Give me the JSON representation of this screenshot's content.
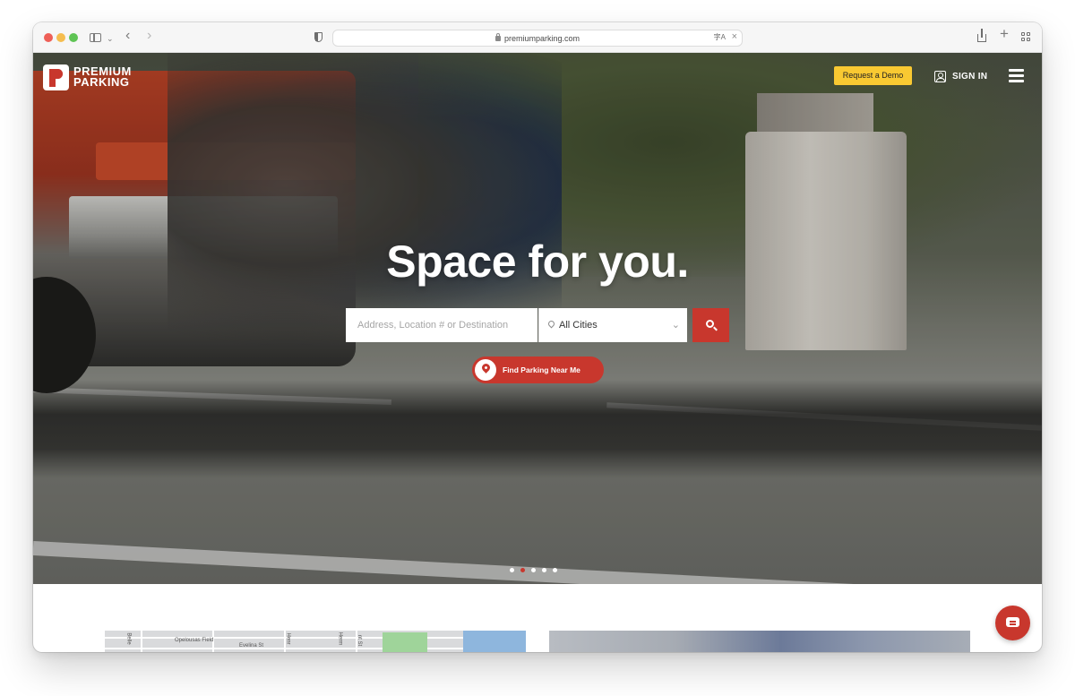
{
  "browser": {
    "url": "premiumparking.com"
  },
  "site": {
    "logo_line1": "PREMIUM",
    "logo_line2": "PARKING",
    "request_demo_label": "Request a Demo",
    "sign_in_label": "SIGN IN"
  },
  "hero": {
    "headline": "Space for you.",
    "search_placeholder": "Address, Location # or Destination",
    "city_selected": "All Cities",
    "find_near_label": "Find Parking Near Me",
    "slides_total": 5,
    "slide_active": 2
  },
  "map": {
    "labels": [
      "Opelousas Field",
      "Evelina St",
      "Belle",
      "Henr",
      "Herm",
      "nt St"
    ]
  },
  "colors": {
    "brand_red": "#c8372d",
    "demo_yellow": "#f9c932"
  },
  "icons": [
    "sidebar-icon",
    "back-icon",
    "forward-icon",
    "shield-icon",
    "lock-icon",
    "translate-icon",
    "share-icon",
    "plus-icon",
    "tabs-icon",
    "user-icon",
    "menu-icon",
    "pin-icon",
    "search-icon",
    "location-pin-icon",
    "chat-icon"
  ]
}
